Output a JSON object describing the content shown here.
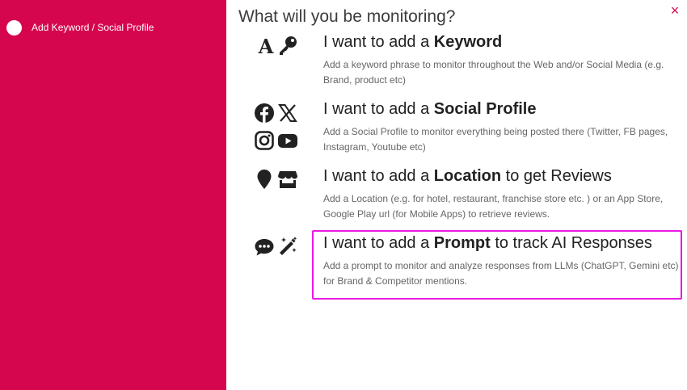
{
  "sidebar": {
    "steps": [
      {
        "label": "Add Keyword / Social Profile"
      }
    ]
  },
  "heading": "What will you be monitoring?",
  "close_label": "×",
  "options": [
    {
      "title_prefix": "I want to add a ",
      "title_bold": "Keyword",
      "title_suffix": "",
      "description": "Add a keyword phrase to monitor throughout the Web and/or Social Media (e.g. Brand, product etc)",
      "icons": [
        "letter-a-icon",
        "key-icon"
      ]
    },
    {
      "title_prefix": "I want to add a ",
      "title_bold": "Social Profile",
      "title_suffix": "",
      "description": "Add a Social Profile to monitor everything being posted there (Twitter, FB pages, Instagram, Youtube etc)",
      "icons": [
        "facebook-icon",
        "x-icon",
        "instagram-icon",
        "youtube-icon"
      ]
    },
    {
      "title_prefix": "I want to add a ",
      "title_bold": "Location",
      "title_suffix": " to get Reviews",
      "description": "Add a Location (e.g. for hotel, restaurant, franchise store etc. ) or an App Store, Google Play url (for Mobile Apps) to retrieve reviews.",
      "icons": [
        "map-pin-icon",
        "store-icon"
      ]
    },
    {
      "title_prefix": "I want to add a ",
      "title_bold": "Prompt",
      "title_suffix": " to track AI Responses",
      "description": "Add a prompt to monitor and analyze responses from LLMs (ChatGPT, Gemini etc) for Brand & Competitor mentions.",
      "icons": [
        "chat-bubble-icon",
        "magic-wand-icon"
      ],
      "highlighted": true
    }
  ],
  "colors": {
    "sidebar_bg": "#d6064e",
    "highlight_border": "#ea19e3",
    "close_icon": "#d6064e"
  }
}
